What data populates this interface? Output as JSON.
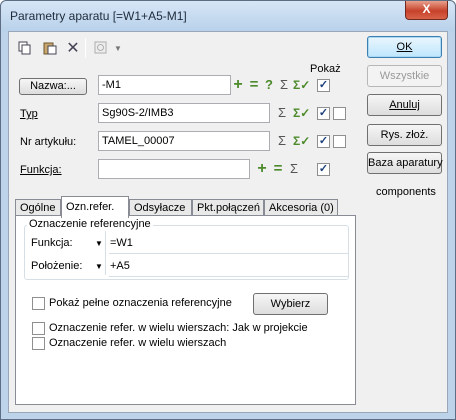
{
  "window": {
    "title": "Parametry aparatu [=W1+A5-M1]",
    "close_glyph": "X"
  },
  "toolbar": {
    "icons": [
      "copy-icon",
      "paste-icon",
      "delete-icon",
      "component-icon",
      "dropdown-arrow-icon"
    ]
  },
  "header": {
    "pokaz_label": "Pokaż"
  },
  "fields": {
    "nazwa": {
      "label": "Nazwa:...",
      "value": "-M1",
      "show": true
    },
    "typ": {
      "label": "Typ",
      "value": "Sg90S-2/IMB3",
      "show": true,
      "extra": false
    },
    "nr_artykulu": {
      "label": "Nr artykułu:",
      "value": "TAMEL_00007",
      "show": true,
      "extra": false
    },
    "funkcja": {
      "label": "Funkcja:",
      "value": "",
      "show": true
    }
  },
  "side_buttons": {
    "ok": "OK",
    "wszystkie": "Wszystkie",
    "anuluj": "Anuluj",
    "rys": "Rys. złoż.",
    "baza": "Baza aparatury",
    "components": "components"
  },
  "tabs": [
    {
      "label": "Ogólne",
      "active": false
    },
    {
      "label": "Ozn.refer.",
      "active": true
    },
    {
      "label": "Odsyłacze",
      "active": false
    },
    {
      "label": "Pkt.połączeń",
      "active": false
    },
    {
      "label": "Akcesoria (0)",
      "active": false
    }
  ],
  "panel": {
    "group_title": "Oznaczenie referencyjne",
    "funkcja_label": "Funkcja:",
    "funkcja_value": "=W1",
    "polozenie_label": "Położenie:",
    "polozenie_value": "+A5",
    "pokaz_pelne": "Pokaż pełne oznaczenia referencyjne",
    "pokaz_pelne_checked": false,
    "wybierz": "Wybierz",
    "wiele_jak": "Oznaczenie refer. w wielu wierszach: Jak w projekcie",
    "wiele_jak_checked": false,
    "wiele": "Oznaczenie refer. w wielu wierszach",
    "wiele_checked": false
  },
  "glyphs": {
    "plus": "+",
    "minus": "=",
    "question": "?",
    "sigma": "Σ",
    "check_sum": "Σ✓",
    "checked": "✓",
    "dropdown": "▼",
    "small_arrow": "▾"
  }
}
